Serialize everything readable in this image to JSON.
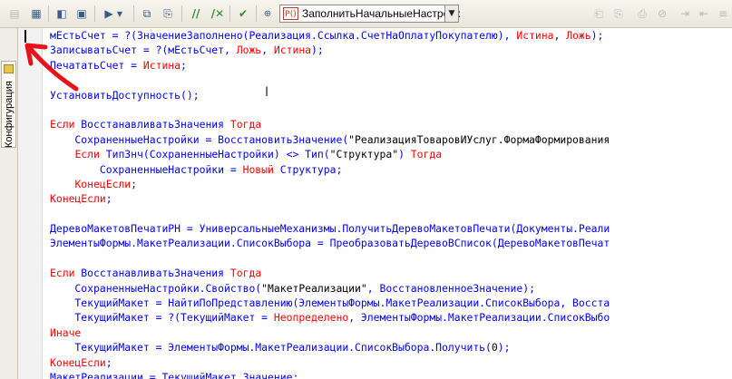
{
  "toolbar": {
    "procedure_selector": {
      "icon_label": "P()",
      "value": "ЗаполнитьНачальныеНастройк"
    }
  },
  "side_panel": {
    "config_tab_label": "Конфигурация"
  },
  "colors": {
    "identifier": "#0000ff",
    "keyword": "#ff0000",
    "literal": "#000000",
    "annotation_arrow": "#e8121a"
  },
  "code_lines": [
    [
      {
        "t": "мЕстьСчет = ?(ЗначениеЗаполнено(Реализация.Ссылка.СчетНаОплатуПокупателю), ",
        "c": "id"
      },
      {
        "t": "Истина",
        "c": "kw"
      },
      {
        "t": ", ",
        "c": "id"
      },
      {
        "t": "Ложь",
        "c": "kw"
      },
      {
        "t": ");",
        "c": "id"
      }
    ],
    [
      {
        "t": "ЗаписыватьСчет = ?(мЕстьСчет, ",
        "c": "id"
      },
      {
        "t": "Ложь",
        "c": "kw"
      },
      {
        "t": ", ",
        "c": "id"
      },
      {
        "t": "Истина",
        "c": "kw"
      },
      {
        "t": ");",
        "c": "id"
      }
    ],
    [
      {
        "t": "ПечататьСчет = ",
        "c": "id"
      },
      {
        "t": "Истина",
        "c": "kw"
      },
      {
        "t": ";",
        "c": "id"
      }
    ],
    [],
    [
      {
        "t": "УстановитьДоступность();",
        "c": "id"
      }
    ],
    [],
    [
      {
        "t": "Если ",
        "c": "kw"
      },
      {
        "t": "ВосстанавливатьЗначения ",
        "c": "id"
      },
      {
        "t": "Тогда",
        "c": "kw"
      }
    ],
    [
      {
        "t": "    СохраненныеНастройки = ВосстановитьЗначение(",
        "c": "id"
      },
      {
        "t": "\"РеализацияТоваровИУслуг.ФормаФормирования",
        "c": "str"
      }
    ],
    [
      {
        "t": "    ",
        "c": "id"
      },
      {
        "t": "Если ",
        "c": "kw"
      },
      {
        "t": "ТипЗнч(СохраненныеНастройки) <> Тип(",
        "c": "id"
      },
      {
        "t": "\"Структура\"",
        "c": "str"
      },
      {
        "t": ") ",
        "c": "id"
      },
      {
        "t": "Тогда",
        "c": "kw"
      }
    ],
    [
      {
        "t": "        СохраненныеНастройки = ",
        "c": "id"
      },
      {
        "t": "Новый ",
        "c": "kw"
      },
      {
        "t": "Структура;",
        "c": "id"
      }
    ],
    [
      {
        "t": "    ",
        "c": "id"
      },
      {
        "t": "КонецЕсли",
        "c": "kw"
      },
      {
        "t": ";",
        "c": "id"
      }
    ],
    [
      {
        "t": "КонецЕсли",
        "c": "kw"
      },
      {
        "t": ";",
        "c": "id"
      }
    ],
    [],
    [
      {
        "t": "ДеревоМакетовПечатиРН = УниверсальныеМеханизмы.ПолучитьДеревоМакетовПечати(Документы.Реали",
        "c": "id"
      }
    ],
    [
      {
        "t": "ЭлементыФормы.МакетРеализации.СписокВыбора = ПреобразоватьДеревоВСписок(ДеревоМакетовПечат",
        "c": "id"
      }
    ],
    [],
    [
      {
        "t": "Если ",
        "c": "kw"
      },
      {
        "t": "ВосстанавливатьЗначения ",
        "c": "id"
      },
      {
        "t": "Тогда",
        "c": "kw"
      }
    ],
    [
      {
        "t": "    СохраненныеНастройки.Свойство(",
        "c": "id"
      },
      {
        "t": "\"МакетРеализации\"",
        "c": "str"
      },
      {
        "t": ", ВосстановленноеЗначение);",
        "c": "id"
      }
    ],
    [
      {
        "t": "    ТекущийМакет = НайтиПоПредставлению(ЭлементыФормы.МакетРеализации.СписокВыбора, Восста",
        "c": "id"
      }
    ],
    [
      {
        "t": "    ТекущийМакет = ?(ТекущийМакет = ",
        "c": "id"
      },
      {
        "t": "Неопределено",
        "c": "kw"
      },
      {
        "t": ", ЭлементыФормы.МакетРеализации.СписокВыбо",
        "c": "id"
      }
    ],
    [
      {
        "t": "Иначе",
        "c": "kw"
      }
    ],
    [
      {
        "t": "    ТекущийМакет = ЭлементыФормы.МакетРеализации.СписокВыбора.Получить(",
        "c": "id"
      },
      {
        "t": "0",
        "c": "num"
      },
      {
        "t": ");",
        "c": "id"
      }
    ],
    [
      {
        "t": "КонецЕсли",
        "c": "kw"
      },
      {
        "t": ";",
        "c": "id"
      }
    ],
    [
      {
        "t": "МакетРеализации = ТекущийМакет.Значение;",
        "c": "id"
      }
    ]
  ]
}
